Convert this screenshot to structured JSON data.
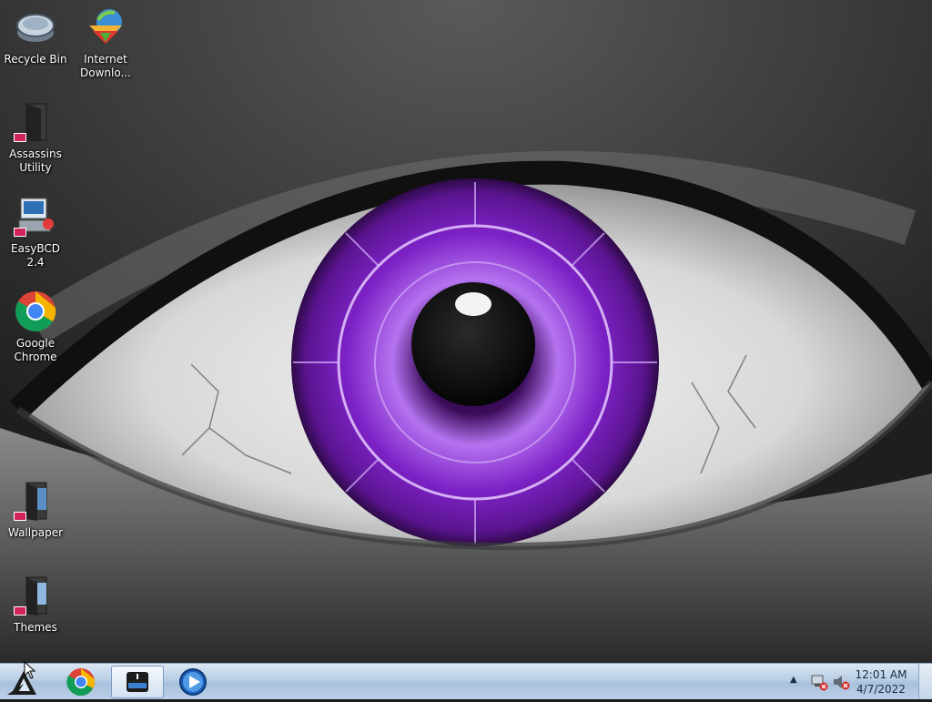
{
  "desktop": {
    "icons": [
      {
        "label": "Recycle Bin",
        "icon": "recycle-bin-icon"
      },
      {
        "label": "Internet Downlo...",
        "icon": "internet-download-manager-icon"
      },
      {
        "label": "Assassins Utility",
        "icon": "folder-icon"
      },
      {
        "label": "EasyBCD 2.4",
        "icon": "easybcd-icon"
      },
      {
        "label": "Google Chrome",
        "icon": "chrome-icon"
      },
      {
        "label": "Wallpaper",
        "icon": "folder-icon"
      },
      {
        "label": "Themes",
        "icon": "folder-icon"
      }
    ]
  },
  "taskbar": {
    "start_icon": "start-logo-icon",
    "pinned": [
      "chrome-icon",
      "file-manager-icon",
      "media-player-icon"
    ],
    "tray": {
      "icons": [
        "show-hidden-icons-chevron",
        "network-disconnected-icon",
        "volume-muted-icon"
      ],
      "time": "12:01 AM",
      "date": "4/7/2022"
    }
  },
  "colors": {
    "iris": "#8a2ed0",
    "taskbar": "#b9cde4"
  }
}
